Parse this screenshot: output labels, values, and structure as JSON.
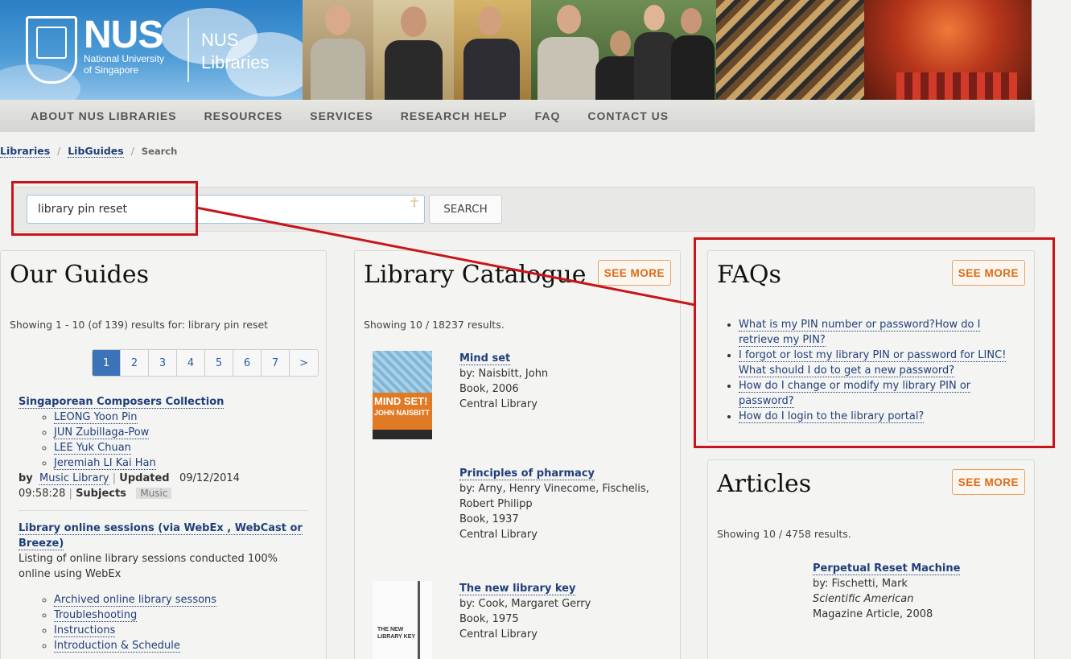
{
  "header": {
    "brand": "NUS",
    "brand_sub_1": "National University",
    "brand_sub_2": "of Singapore",
    "libraries_1": "NUS",
    "libraries_2": "Libraries"
  },
  "nav": {
    "items": [
      "ABOUT NUS LIBRARIES",
      "RESOURCES",
      "SERVICES",
      "RESEARCH HELP",
      "FAQ",
      "CONTACT US"
    ]
  },
  "breadcrumb": {
    "items": [
      "Libraries",
      "LibGuides"
    ],
    "current": "Search"
  },
  "search": {
    "value": "library pin reset",
    "button_label": "SEARCH"
  },
  "guides": {
    "title": "Our Guides",
    "showing": "Showing 1 - 10 (of 139) results for: library pin reset",
    "pages": [
      "1",
      "2",
      "3",
      "4",
      "5",
      "6",
      "7",
      ">"
    ],
    "results": [
      {
        "title": "Singaporean Composers Collection",
        "links": [
          "LEONG Yoon Pin",
          "JUN Zubillaga-Pow",
          "LEE Yuk Chuan",
          "Jeremiah LI Kai Han"
        ],
        "by_label": "by",
        "by": "Music Library",
        "updated_label": "Updated",
        "updated": "09/12/2014",
        "time": "09:58:28",
        "subjects_label": "Subjects",
        "subject": "Music"
      },
      {
        "title": "Library online sessions (via WebEx , WebCast or Breeze)",
        "desc": "Listing of online library sessions conducted 100% online using WebEx",
        "links": [
          "Archived online library sessons",
          "Troubleshooting",
          "Instructions",
          "Introduction & Schedule"
        ]
      }
    ]
  },
  "catalogue": {
    "title": "Library Catalogue",
    "see_more": "SEE MORE",
    "showing": "Showing 10 / 18237 results.",
    "items": [
      {
        "title": "Mind set",
        "by": "by: Naisbitt, John",
        "type": "Book, 2006",
        "location": "Central Library",
        "cover_text_1": "MIND SET!",
        "cover_text_2": "JOHN NAISBITT"
      },
      {
        "title": "Principles of pharmacy",
        "by_1": "by: Arny, Henry Vinecome, Fischelis,",
        "by_2": "Robert Philipp",
        "type": "Book, 1937",
        "location": "Central Library"
      },
      {
        "title": "The new library key",
        "by": "by: Cook, Margaret Gerry",
        "type": "Book, 1975",
        "location": "Central Library",
        "cover_text_1": "THE NEW",
        "cover_text_2": "LIBRARY KEY"
      }
    ]
  },
  "faqs": {
    "title": "FAQs",
    "see_more": "SEE MORE",
    "items": [
      [
        "What is my PIN number or password?How do I",
        "retrieve my PIN?"
      ],
      [
        "I forgot or lost my library PIN or password for LINC!",
        "What should I do to get a new password?"
      ],
      [
        "How do I change or modify my library PIN or",
        "password?"
      ],
      [
        "How do I login to the library portal?"
      ]
    ]
  },
  "articles": {
    "title": "Articles",
    "see_more": "SEE MORE",
    "showing": "Showing 10 / 4758 results.",
    "item": {
      "title": "Perpetual Reset Machine",
      "by": "by: Fischetti, Mark",
      "journal": "Scientific American",
      "type": "Magazine Article, 2008"
    }
  },
  "colors": {
    "annotation": "#c8151b",
    "link": "#1f3f7a",
    "accent": "#e06a14"
  }
}
